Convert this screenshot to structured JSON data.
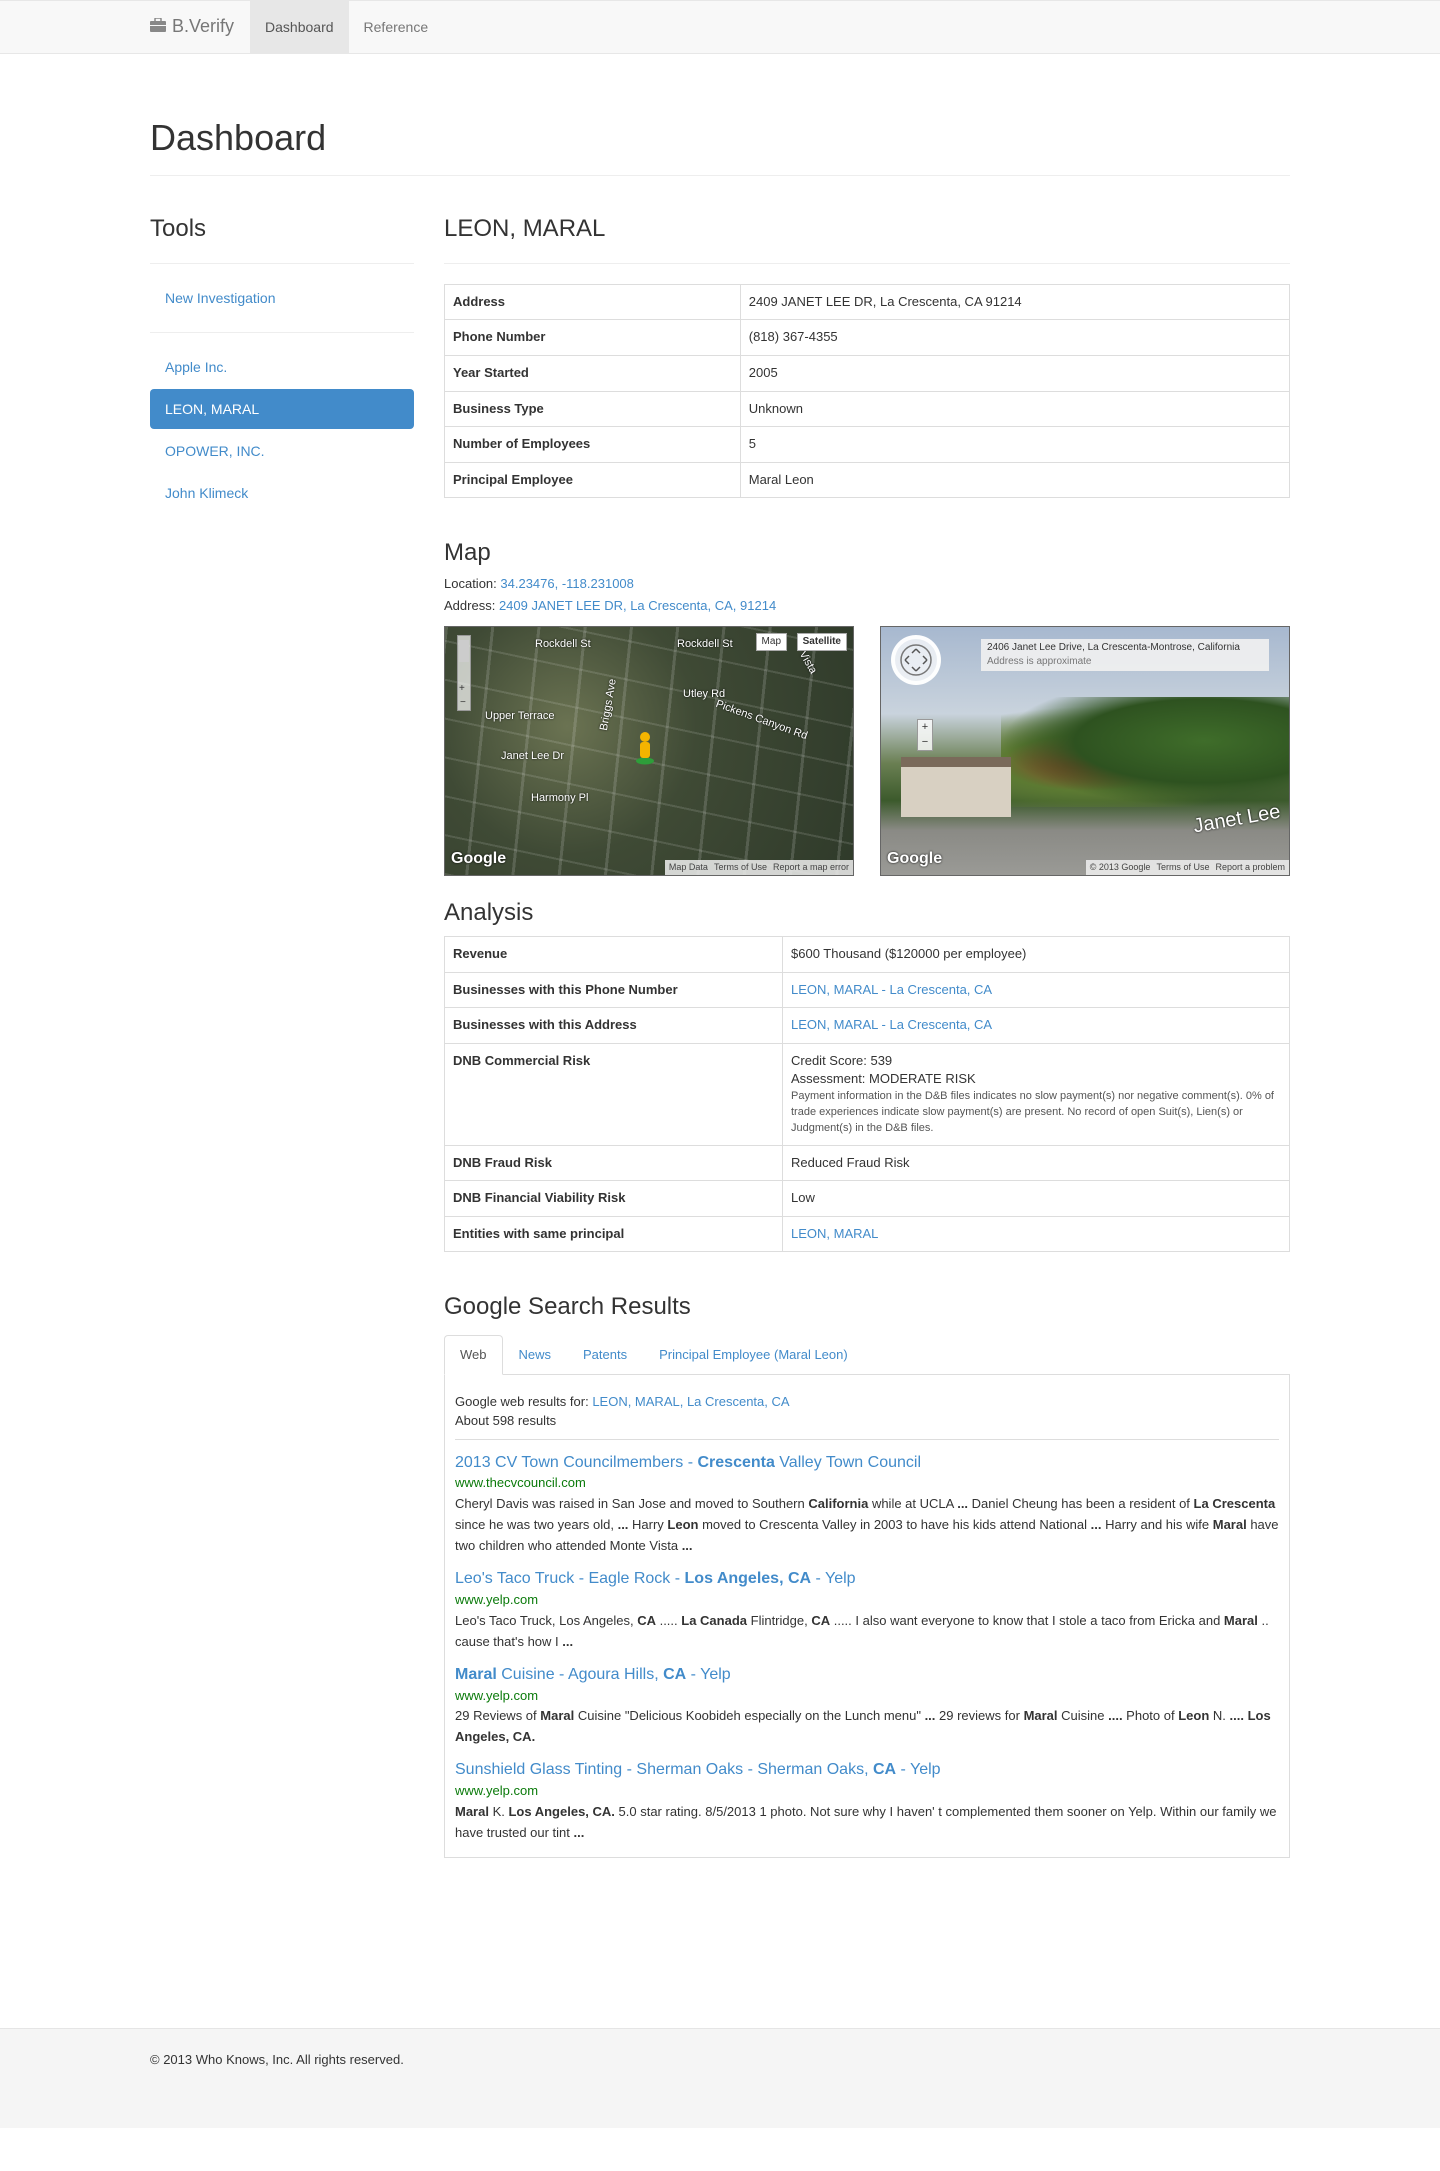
{
  "nav": {
    "brand": "B.Verify",
    "items": [
      "Dashboard",
      "Reference"
    ]
  },
  "page_title": "Dashboard",
  "sidebar": {
    "title": "Tools",
    "new_investigation": "New Investigation",
    "items": [
      "Apple Inc.",
      "LEON, MARAL",
      "OPOWER, INC.",
      "John Klimeck"
    ]
  },
  "entity": {
    "name": "LEON, MARAL",
    "details": [
      {
        "k": "Address",
        "v": "2409 JANET LEE DR, La Crescenta, CA 91214"
      },
      {
        "k": "Phone Number",
        "v": "(818) 367-4355"
      },
      {
        "k": "Year Started",
        "v": "2005"
      },
      {
        "k": "Business Type",
        "v": "Unknown"
      },
      {
        "k": "Number of Employees",
        "v": "5"
      },
      {
        "k": "Principal Employee",
        "v": "Maral Leon"
      }
    ]
  },
  "map": {
    "title": "Map",
    "location_label": "Location:",
    "location_value": "34.23476, -118.231008",
    "address_label": "Address:",
    "address_value": "2409 JANET LEE DR, La Crescenta, CA, 91214",
    "sat_labels": [
      "Rockdell St",
      "Rockdell St",
      "Utley Rd",
      "Upper Terrace",
      "Pickens Canyon Rd",
      "Janet Lee Dr",
      "Briggs Ave",
      "Harmony Pl",
      "Vista"
    ],
    "btn_map": "Map",
    "btn_satellite": "Satellite",
    "google": "Google",
    "attrib_left": [
      "Map Data",
      "Terms of Use",
      "Report a map error"
    ],
    "street_address": "2406 Janet Lee Drive, La Crescenta-Montrose, California",
    "street_approx": "Address is approximate",
    "street_sign": "Janet Lee",
    "attrib_right": [
      "© 2013 Google",
      "Terms of Use",
      "Report a problem"
    ]
  },
  "analysis": {
    "title": "Analysis",
    "revenue": {
      "k": "Revenue",
      "v": "$600 Thousand ($120000 per employee)"
    },
    "phone": {
      "k": "Businesses with this Phone Number",
      "v": "LEON, MARAL - La Crescenta, CA"
    },
    "address": {
      "k": "Businesses with this Address",
      "v": "LEON, MARAL - La Crescenta, CA"
    },
    "commercial": {
      "k": "DNB Commercial Risk",
      "score": "Credit Score: 539",
      "assessment": "Assessment: MODERATE RISK",
      "note": "Payment information in the D&B files indicates no slow payment(s) nor negative comment(s). 0% of trade experiences indicate slow payment(s) are present. No record of open Suit(s), Lien(s) or Judgment(s) in the D&B files."
    },
    "fraud": {
      "k": "DNB Fraud Risk",
      "v": "Reduced Fraud Risk"
    },
    "viability": {
      "k": "DNB Financial Viability Risk",
      "v": "Low"
    },
    "principal": {
      "k": "Entities with same principal",
      "v": "LEON, MARAL"
    }
  },
  "search": {
    "title": "Google Search Results",
    "tabs": [
      "Web",
      "News",
      "Patents",
      "Principal Employee (Maral Leon)"
    ],
    "for_label": "Google web results for:",
    "for_value": "LEON, MARAL, La Crescenta, CA",
    "count": "About 598 results",
    "results": [
      {
        "title": "2013 CV Town Councilmembers - <b>Crescenta</b> Valley Town Council",
        "url": "www.thecvcouncil.com",
        "snippet": "Cheryl Davis was raised in San Jose and moved to Southern <b>California</b> while at UCLA <b>...</b> Daniel Cheung has been a resident of <b>La Crescenta</b> since he was two years old, <b>...</b> Harry <b>Leon</b> moved to Crescenta Valley in 2003 to have his kids attend National <b>...</b> Harry and his wife <b>Maral</b> have two children who attended Monte Vista <b>...</b>"
      },
      {
        "title": "Leo's Taco Truck - Eagle Rock - <b>Los Angeles, CA</b> - Yelp",
        "url": "www.yelp.com",
        "snippet": "Leo's Taco Truck, Los Angeles, <b>CA</b> ..... <b>La Canada</b> Flintridge, <b>CA</b> ..... I also want everyone to know that I stole a taco from Ericka and <b>Maral</b> .. cause that's how I <b>...</b>"
      },
      {
        "title": "<b>Maral</b> Cuisine - Agoura Hills, <b>CA</b> - Yelp",
        "url": "www.yelp.com",
        "snippet": "29 Reviews of <b>Maral</b> Cuisine \"Delicious Koobideh especially on the Lunch menu\" <b>...</b> 29 reviews for <b>Maral</b> Cuisine <b>....</b> Photo of <b>Leon</b> N. <b>.... Los Angeles, CA.</b>"
      },
      {
        "title": "Sunshield Glass Tinting - Sherman Oaks - Sherman Oaks, <b>CA</b> - Yelp",
        "url": "www.yelp.com",
        "snippet": "<b>Maral</b> K. <b>Los Angeles, CA.</b> 5.0 star rating. 8/5/2013 1 photo. Not sure why I haven' t complemented them sooner on Yelp. Within our family we have trusted our tint <b>...</b>"
      }
    ]
  },
  "footer": "© 2013 Who Knows, Inc. All rights reserved."
}
